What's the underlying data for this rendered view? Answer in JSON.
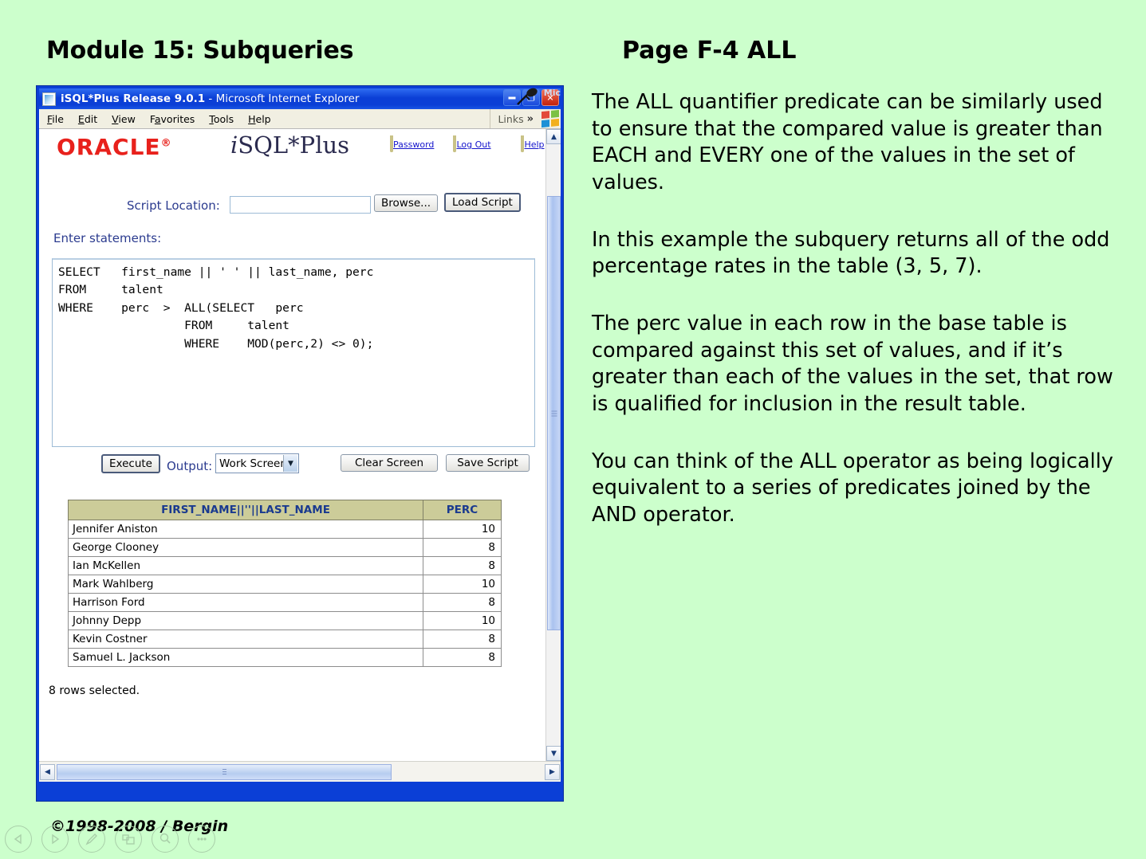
{
  "slide": {
    "title": "Module 15: Subqueries",
    "page_label": "Page F-4  ALL",
    "copyright": "©1998-2008 / Bergin",
    "background_color": "#CCFFCC"
  },
  "browser": {
    "title_bold": "iSQL*Plus Release 9.0.1",
    "title_rest": " - Microsoft Internet Explorer",
    "window_buttons": [
      "minimize",
      "restore",
      "close"
    ],
    "overlay_label": "Mic",
    "menu": [
      {
        "label": "File",
        "accel": "F"
      },
      {
        "label": "Edit",
        "accel": "E"
      },
      {
        "label": "View",
        "accel": "V"
      },
      {
        "label": "Favorites",
        "accel": "a"
      },
      {
        "label": "Tools",
        "accel": "T"
      },
      {
        "label": "Help",
        "accel": "H"
      }
    ],
    "links_label": "Links",
    "links_chevron": "»"
  },
  "isqlplus": {
    "oracle_logo": "ORACLE",
    "oracle_tm": "®",
    "product_i": "i",
    "product_rest": "SQL*Plus",
    "top_links": [
      "Password",
      "Log Out",
      "Help"
    ],
    "script_location_label": "Script Location:",
    "script_location_value": "",
    "script_location_placeholder": "",
    "browse_button": "Browse...",
    "load_script_button": "Load Script",
    "enter_statements_label": "Enter statements:",
    "sql": "SELECT   first_name || ' ' || last_name, perc\nFROM     talent\nWHERE    perc  >  ALL(SELECT   perc\n                  FROM     talent\n                  WHERE    MOD(perc,2) <> 0);",
    "execute_button": "Execute",
    "output_label": "Output:",
    "output_selected": "Work Screen",
    "output_options": [
      "Work Screen"
    ],
    "clear_screen_button": "Clear Screen",
    "save_script_button": "Save Script",
    "rows_selected": "8 rows selected."
  },
  "results_table": {
    "columns": [
      "FIRST_NAME||''||LAST_NAME",
      "PERC"
    ],
    "rows": [
      {
        "name": "Jennifer Aniston",
        "perc": "10"
      },
      {
        "name": "George Clooney",
        "perc": "8"
      },
      {
        "name": "Ian McKellen",
        "perc": "8"
      },
      {
        "name": "Mark Wahlberg",
        "perc": "10"
      },
      {
        "name": "Harrison Ford",
        "perc": "8"
      },
      {
        "name": "Johnny Depp",
        "perc": "10"
      },
      {
        "name": "Kevin Costner",
        "perc": "8"
      },
      {
        "name": "Samuel L. Jackson",
        "perc": "8"
      }
    ],
    "header_color": "#CCCC99",
    "header_text_color": "#1A3A8F"
  },
  "notes": {
    "p1": "The ALL quantifier predicate can be similarly used to ensure that the compared value is greater than EACH and EVERY one of the values in the set of values.",
    "p2": "In this example the subquery returns all of the odd percentage rates in the table (3, 5, 7).",
    "p3": "The perc value in each row in the base table is compared against this set of values, and if it’s greater than each of the values in the set, that row is qualified for inclusion in the result table.",
    "p4": "You can think of the ALL operator as being logically equivalent to a series of predicates joined by the AND  operator."
  },
  "nav_buttons": [
    "previous",
    "next",
    "pen",
    "duplicate",
    "zoom",
    "more"
  ]
}
